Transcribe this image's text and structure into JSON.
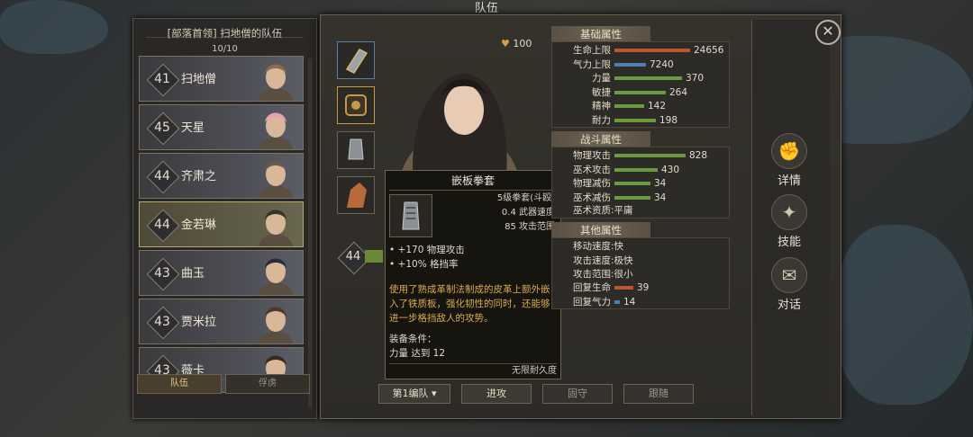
{
  "window_title": "队伍",
  "party": {
    "header": "[部落首领] 扫地僧的队伍",
    "count": "10/10",
    "members": [
      {
        "level": "41",
        "name": "扫地僧"
      },
      {
        "level": "45",
        "name": "天星"
      },
      {
        "level": "44",
        "name": "齐肃之"
      },
      {
        "level": "44",
        "name": "金若琳"
      },
      {
        "level": "43",
        "name": "曲玉"
      },
      {
        "level": "43",
        "name": "贾米拉"
      },
      {
        "level": "43",
        "name": "薇卡"
      }
    ],
    "tabs": [
      "队伍",
      "俘虏"
    ]
  },
  "hero": {
    "loyalty": "100",
    "level": "44"
  },
  "tooltip": {
    "name": "嵌板拳套",
    "type": "5级拳套(斗殴)",
    "speed": "0.4 武器速度",
    "range": "85 攻击范围",
    "bonuses": [
      "• +170 物理攻击",
      "• +10% 格挡率"
    ],
    "description": "使用了熟成革制法制成的皮革上额外嵌入了铁质板，强化韧性的同时，还能够进一步格挡敌人的攻势。",
    "req_title": "装备条件：",
    "req_value": "力量 达到 12",
    "durability": "无限耐久度"
  },
  "stats": {
    "basic_title": "基础属性",
    "basic": [
      {
        "label": "生命上限",
        "value": "24656",
        "color": "#c0552f",
        "fill": 0.95
      },
      {
        "label": "气力上限",
        "value": "7240",
        "color": "#4e7fb3",
        "fill": 0.4
      },
      {
        "label": "力量",
        "value": "370",
        "color": "#6a9a3c",
        "fill": 0.85
      },
      {
        "label": "敏捷",
        "value": "264",
        "color": "#6a9a3c",
        "fill": 0.65
      },
      {
        "label": "精神",
        "value": "142",
        "color": "#6a9a3c",
        "fill": 0.38
      },
      {
        "label": "耐力",
        "value": "198",
        "color": "#6a9a3c",
        "fill": 0.52
      }
    ],
    "combat_title": "战斗属性",
    "combat": [
      {
        "label": "物理攻击",
        "value": "828",
        "color": "#6a9a3c",
        "fill": 0.9
      },
      {
        "label": "巫术攻击",
        "value": "430",
        "color": "#6a9a3c",
        "fill": 0.55
      },
      {
        "label": "物理减伤",
        "value": "34",
        "color": "#6a9a3c",
        "fill": 0.45
      },
      {
        "label": "巫术减伤",
        "value": "34",
        "color": "#6a9a3c",
        "fill": 0.45
      }
    ],
    "aptitude_label": "巫术资质",
    "aptitude_value": "平庸",
    "other_title": "其他属性",
    "other": [
      {
        "label": "移动速度",
        "value": "快"
      },
      {
        "label": "攻击速度",
        "value": "极快"
      },
      {
        "label": "攻击范围",
        "value": "很小"
      }
    ],
    "regen": [
      {
        "label": "回复生命",
        "value": "39",
        "color": "#c0552f",
        "fill": 0.3
      },
      {
        "label": "回复气力",
        "value": "14",
        "color": "#4e7fb3",
        "fill": 0.08
      }
    ]
  },
  "side_menu": [
    "详情",
    "技能",
    "对话"
  ],
  "bottom_buttons": [
    "第1编队",
    "进攻",
    "固守",
    "跟随"
  ],
  "close_label": "✕"
}
